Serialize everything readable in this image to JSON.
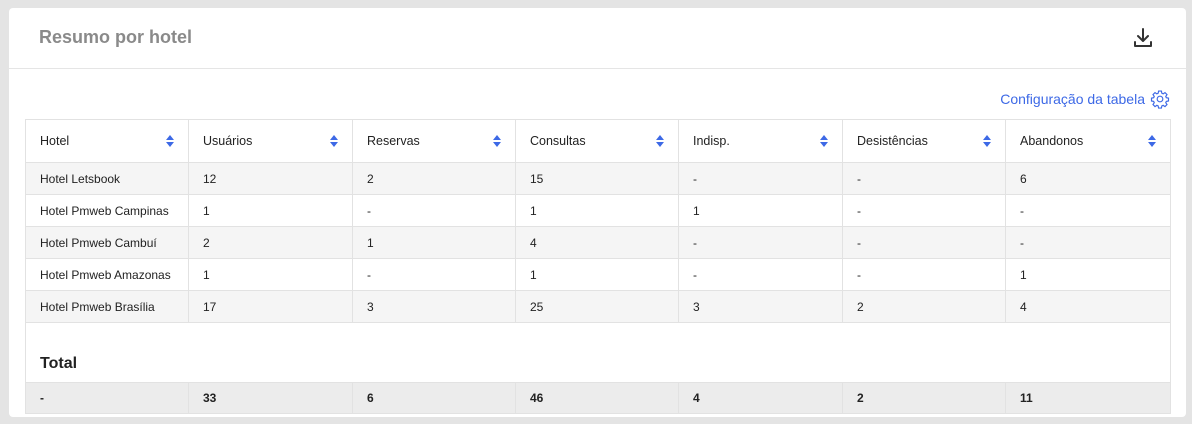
{
  "header": {
    "title": "Resumo por hotel",
    "download_icon": "download-icon"
  },
  "config": {
    "label": "Configuração da tabela",
    "icon": "gear-icon",
    "color": "#3d69e6"
  },
  "table": {
    "columns": [
      "Hotel",
      "Usuários",
      "Reservas",
      "Consultas",
      "Indisp.",
      "Desistências",
      "Abandonos"
    ],
    "rows": [
      [
        "Hotel Letsbook",
        "12",
        "2",
        "15",
        "-",
        "-",
        "6"
      ],
      [
        "Hotel Pmweb Campinas",
        "1",
        "-",
        "1",
        "1",
        "-",
        "-"
      ],
      [
        "Hotel Pmweb Cambuí",
        "2",
        "1",
        "4",
        "-",
        "-",
        "-"
      ],
      [
        "Hotel Pmweb Amazonas",
        "1",
        "-",
        "1",
        "-",
        "-",
        "1"
      ],
      [
        "Hotel Pmweb Brasília",
        "17",
        "3",
        "25",
        "3",
        "2",
        "4"
      ]
    ],
    "total_label": "Total",
    "total_row": [
      "-",
      "33",
      "6",
      "46",
      "4",
      "2",
      "11"
    ]
  }
}
